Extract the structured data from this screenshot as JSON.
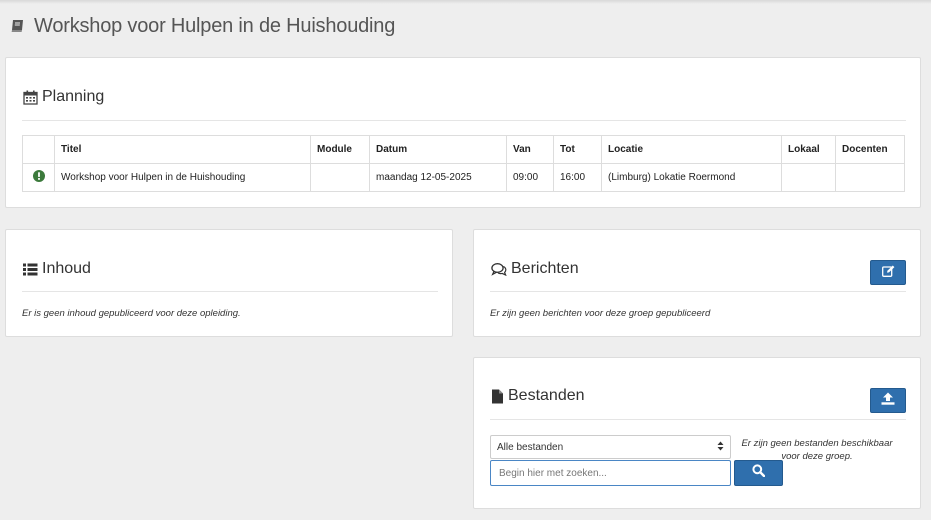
{
  "header": {
    "icon": "book-icon",
    "title": "Workshop voor Hulpen in de Huishouding"
  },
  "planning": {
    "icon": "calendar-icon",
    "title": "Planning",
    "columns": [
      "",
      "Titel",
      "Module",
      "Datum",
      "Van",
      "Tot",
      "Locatie",
      "Lokaal",
      "Docenten"
    ],
    "rows": [
      {
        "status_icon": "exclamation-circle-icon",
        "status_color": "#3c7a3c",
        "titel": "Workshop voor Hulpen in de Huishouding",
        "module": "",
        "datum": "maandag 12-05-2025",
        "van": "09:00",
        "tot": "16:00",
        "locatie": "(Limburg) Lokatie Roermond",
        "lokaal": "",
        "docenten": ""
      }
    ]
  },
  "inhoud": {
    "icon": "list-icon",
    "title": "Inhoud",
    "empty_message": "Er is geen inhoud gepubliceerd voor deze opleiding."
  },
  "berichten": {
    "icon": "comments-icon",
    "title": "Berichten",
    "new_button_icon": "edit-icon",
    "empty_message": "Er zijn geen berichten voor deze groep gepubliceerd"
  },
  "bestanden": {
    "icon": "file-icon",
    "title": "Bestanden",
    "upload_button_icon": "upload-icon",
    "filter_selected": "Alle bestanden",
    "search_placeholder": "Begin hier met zoeken...",
    "search_button_icon": "search-icon",
    "empty_message": "Er zijn geen bestanden beschikbaar voor deze groep."
  },
  "colors": {
    "accent": "#2f6fad",
    "background": "#eeeeee",
    "panel": "#ffffff",
    "status_green": "#3c7a3c"
  }
}
